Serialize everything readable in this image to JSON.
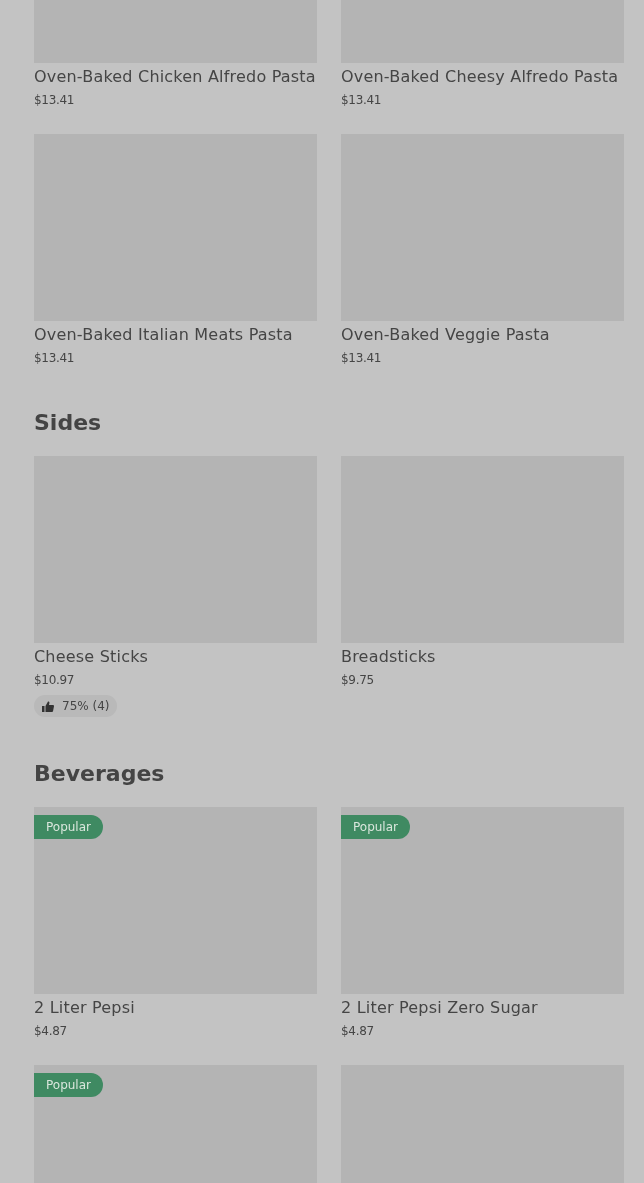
{
  "sections": [
    {
      "items": [
        {
          "kind": "product",
          "name": "Oven-Baked Chicken Alfredo Pasta",
          "price": "$13.41"
        },
        {
          "kind": "product",
          "name": "Oven-Baked Cheesy Alfredo Pasta",
          "price": "$13.41"
        },
        {
          "kind": "product",
          "name": "Oven-Baked Italian Meats Pasta",
          "price": "$13.41"
        },
        {
          "kind": "product",
          "name": "Oven-Baked Veggie Pasta",
          "price": "$13.41"
        }
      ]
    },
    {
      "title": "Sides",
      "items": [
        {
          "kind": "product",
          "name": "Cheese Sticks",
          "price": "$10.97",
          "rating": "75% (4)"
        },
        {
          "kind": "product",
          "name": "Breadsticks",
          "price": "$9.75"
        }
      ]
    },
    {
      "title": "Beverages",
      "items": [
        {
          "kind": "product",
          "name": "2 Liter Pepsi",
          "price": "$4.87",
          "badge": "Popular"
        },
        {
          "kind": "product",
          "name": "2 Liter Pepsi Zero Sugar",
          "price": "$4.87",
          "badge": "Popular"
        },
        {
          "kind": "product",
          "badge": "Popular"
        },
        {
          "kind": "product"
        }
      ]
    }
  ]
}
